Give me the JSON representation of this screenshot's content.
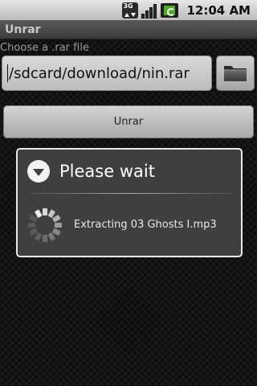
{
  "status_bar": {
    "network": "3G",
    "time": "12:04 AM",
    "icons": [
      "network-3g-icon",
      "signal-icon",
      "battery-icon"
    ]
  },
  "app": {
    "title": "Unrar",
    "choose_label": "Choose a .rar file",
    "path_value": "/sdcard/download/nin.rar",
    "unrar_label": "Unrar"
  },
  "dialog": {
    "title": "Please wait",
    "message": "Extracting 03 Ghosts I.mp3"
  }
}
